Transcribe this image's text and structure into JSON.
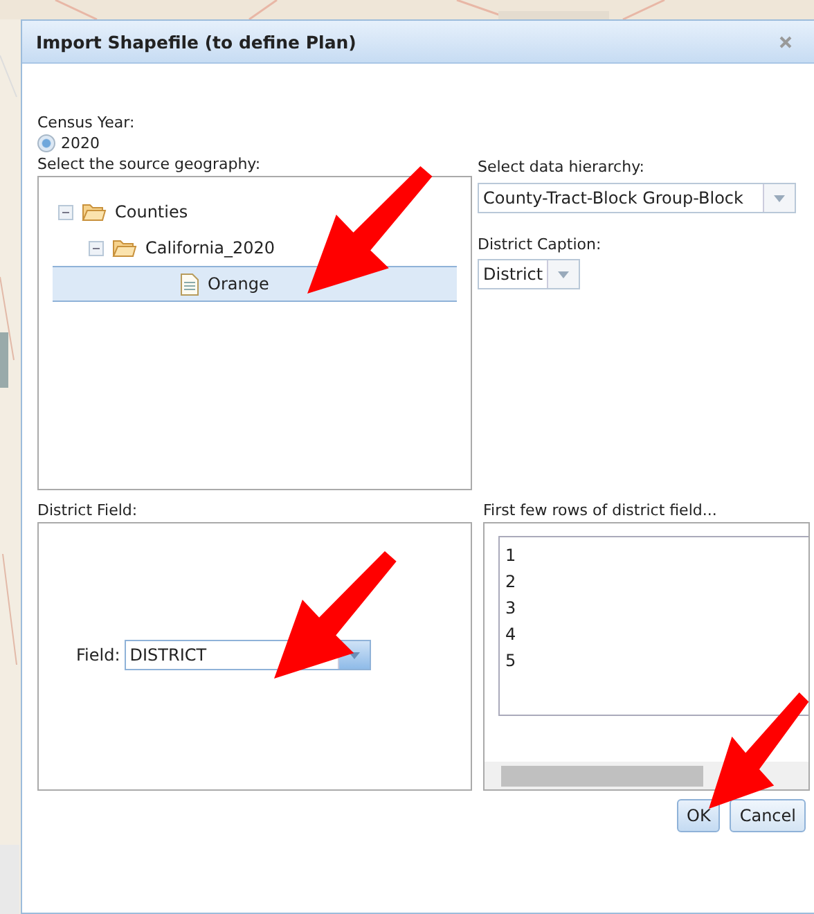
{
  "dialog": {
    "title": "Import Shapefile (to define Plan)"
  },
  "census_year": {
    "label": "Census Year:",
    "options": [
      {
        "label": "2020",
        "selected": true
      }
    ]
  },
  "geography": {
    "label": "Select the source geography:",
    "tree": [
      {
        "label": "Counties",
        "kind": "folder",
        "expanded": true,
        "selected": false,
        "children": [
          {
            "label": "California_2020",
            "kind": "folder",
            "expanded": true,
            "selected": false,
            "children": [
              {
                "label": "Orange",
                "kind": "file",
                "selected": true
              }
            ]
          }
        ]
      }
    ]
  },
  "hierarchy": {
    "label": "Select data hierarchy:",
    "value": "County-Tract-Block Group-Block"
  },
  "caption": {
    "label": "District Caption:",
    "value": "District"
  },
  "district_field": {
    "label": "District Field:",
    "field_label": "Field:",
    "value": "DISTRICT"
  },
  "preview": {
    "label": "First few rows of district field...",
    "rows": [
      "1",
      "2",
      "3",
      "4",
      "5"
    ]
  },
  "buttons": [
    {
      "label": "OK",
      "kind": "primary"
    },
    {
      "label": "Cancel",
      "kind": "secondary"
    }
  ]
}
